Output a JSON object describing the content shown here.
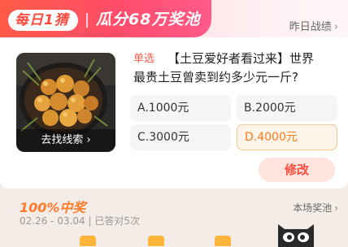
{
  "header": {
    "title": "每日1猜",
    "prize_pool": "瓜分68万奖池",
    "history_link": "昨日战绩"
  },
  "question": {
    "type_tag": "单选",
    "text_line1": "【土豆爱好者看过来】世界",
    "text_line2": "最贵土豆曾卖到约多少元一斤?",
    "image_action": "去找线索",
    "image_icon": "roasted-potatoes-image",
    "options": [
      {
        "label": "A.1000元",
        "selected": false
      },
      {
        "label": "B.2000元",
        "selected": false
      },
      {
        "label": "C.3000元",
        "selected": false
      },
      {
        "label": "D.4000元",
        "selected": true
      }
    ],
    "edit_button": "修改"
  },
  "reward": {
    "title": "100%中奖",
    "subtitle": "02.26 - 03.04 | 已答对5次",
    "pool_link": "本场奖池"
  },
  "colors": {
    "accent": "#ff4d3d",
    "selected_option": "#ff7a1a",
    "header_gradient_start": "#ff5a47",
    "header_gradient_end": "#ff5a8a"
  }
}
